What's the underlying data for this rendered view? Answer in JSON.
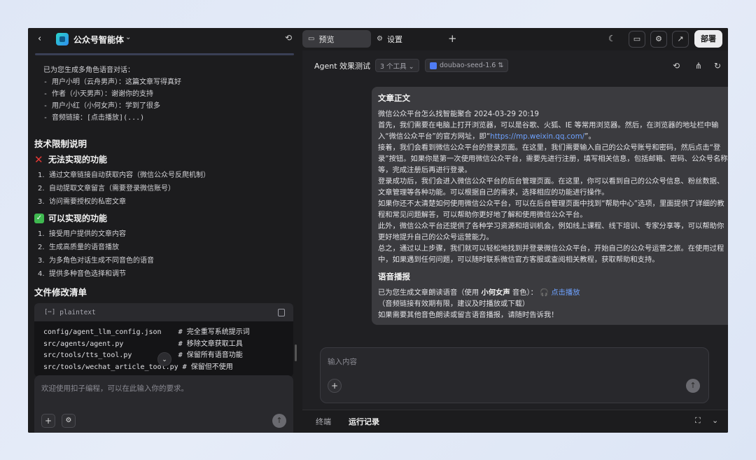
{
  "left_header": {
    "back": "‹",
    "title": "公众号智能体",
    "caret": "⌄",
    "history_icon": "history-icon"
  },
  "chat_lines": [
    "已为您生成多角色语音对话：",
    "- 用户小明（云舟男声）：这篇文章写得真好",
    "- 作者（小天男声）：谢谢你的支持",
    "- 用户小红（小何女声）：学到了很多",
    "- 音频链接：[点击播放](...)"
  ],
  "limits": {
    "title": "技术限制说明",
    "cannot_title": "无法实现的功能",
    "cannot_items": [
      "通过文章链接自动获取内容（微信公众号反爬机制）",
      "自动提取文章留言（需要登录微信账号）",
      "访问需要授权的私密文章"
    ],
    "can_title": "可以实现的功能",
    "can_items": [
      "接受用户提供的文章内容",
      "生成高质量的语音播放",
      "为多角色对话生成不同音色的语音",
      "提供多种音色选择和调节"
    ]
  },
  "files": {
    "title": "文件修改清单",
    "lang": "plaintext",
    "lines": [
      "config/agent_llm_config.json    # 完全重写系统提示词",
      "src/agents/agent.py             # 移除文章获取工具",
      "src/tools/tts_tool.py           # 保留所有语音功能",
      "src/tools/wechat_article_tool.py # 保留但不使用"
    ]
  },
  "left_input": {
    "placeholder": "欢迎使用扣子编程，可以在此输入你的要求。"
  },
  "topbar": {
    "tab_preview": "预览",
    "tab_settings": "设置",
    "plus": "+",
    "deploy": "部署"
  },
  "agent_bar": {
    "title": "Agent 效果测试",
    "tools_pill": "3 个工具 ⌄",
    "model_pill": "doubao-seed-1.6 ⇅"
  },
  "message": {
    "heading": "文章正文",
    "p1": "微信公众平台怎么找智能聚合 2024-03-29 20:19",
    "p2a": "首先，我们需要在电脑上打开浏览器，可以是谷歌、火狐、IE 等常用浏览器。然后，在浏览器的地址栏中输入“微信公众平台”的官方网址，即“",
    "p2link": "https://mp.weixin.qq.com/",
    "p2b": "”。",
    "p3": "接着，我们会看到微信公众平台的登录页面。在这里，我们需要输入自己的公众号账号和密码，然后点击“登录”按钮。如果你是第一次使用微信公众平台，需要先进行注册，填写相关信息，包括邮箱、密码、公众号名称等，完成注册后再进行登录。",
    "p4": "登录成功后，我们会进入微信公众平台的后台管理页面。在这里，你可以看到自己的公众号信息、粉丝数据、文章管理等各种功能。可以根据自己的需求，选择相应的功能进行操作。",
    "p5": "如果你还不太清楚如何使用微信公众平台，可以在后台管理页面中找到“帮助中心”选项，里面提供了详细的教程和常见问题解答，可以帮助你更好地了解和使用微信公众平台。",
    "p6": "此外，微信公众平台还提供了各种学习资源和培训机会，例如线上课程、线下培训、专家分享等，可以帮助你更好地提升自己的公众号运营能力。",
    "p7": "总之，通过以上步骤，我们就可以轻松地找到并登录微信公众平台，开始自己的公众号运营之旅。在使用过程中，如果遇到任何问题，可以随时联系微信官方客服或查阅相关教程，获取帮助和支持。",
    "heading2": "语音播报",
    "v1a": "已为您生成文章朗读语音（使用 ",
    "v1bold": "小何女声",
    "v1b": " 音色）： ",
    "v1link": "点击播放",
    "v2": "（音频链接有效期有限，建议及时播放或下载）",
    "v3": "如果需要其他音色朗读或留言语音播报，请随时告诉我！"
  },
  "right_input": {
    "placeholder": "输入内容"
  },
  "bottom_tabs": {
    "terminal": "终端",
    "run_log": "运行记录"
  },
  "colors": {
    "link": "#6ea2ff",
    "deploy_bg": "#ececee",
    "cross": "#e53935",
    "check": "#3fb950"
  }
}
